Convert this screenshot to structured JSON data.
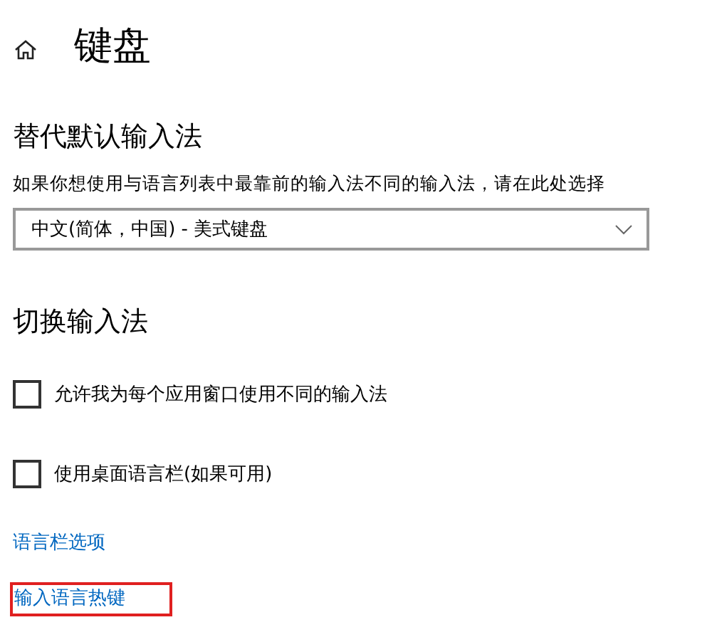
{
  "page": {
    "title": "键盘"
  },
  "override_section": {
    "heading": "替代默认输入法",
    "description": "如果你想使用与语言列表中最靠前的输入法不同的输入法，请在此处选择",
    "dropdown": {
      "value": "中文(简体，中国) - 美式键盘"
    }
  },
  "switch_section": {
    "heading": "切换输入法",
    "options": [
      {
        "label": "允许我为每个应用窗口使用不同的输入法",
        "checked": false
      },
      {
        "label": "使用桌面语言栏(如果可用)",
        "checked": false
      }
    ]
  },
  "links": [
    {
      "label": "语言栏选项",
      "highlighted": false
    },
    {
      "label": "输入语言热键",
      "highlighted": true
    }
  ]
}
